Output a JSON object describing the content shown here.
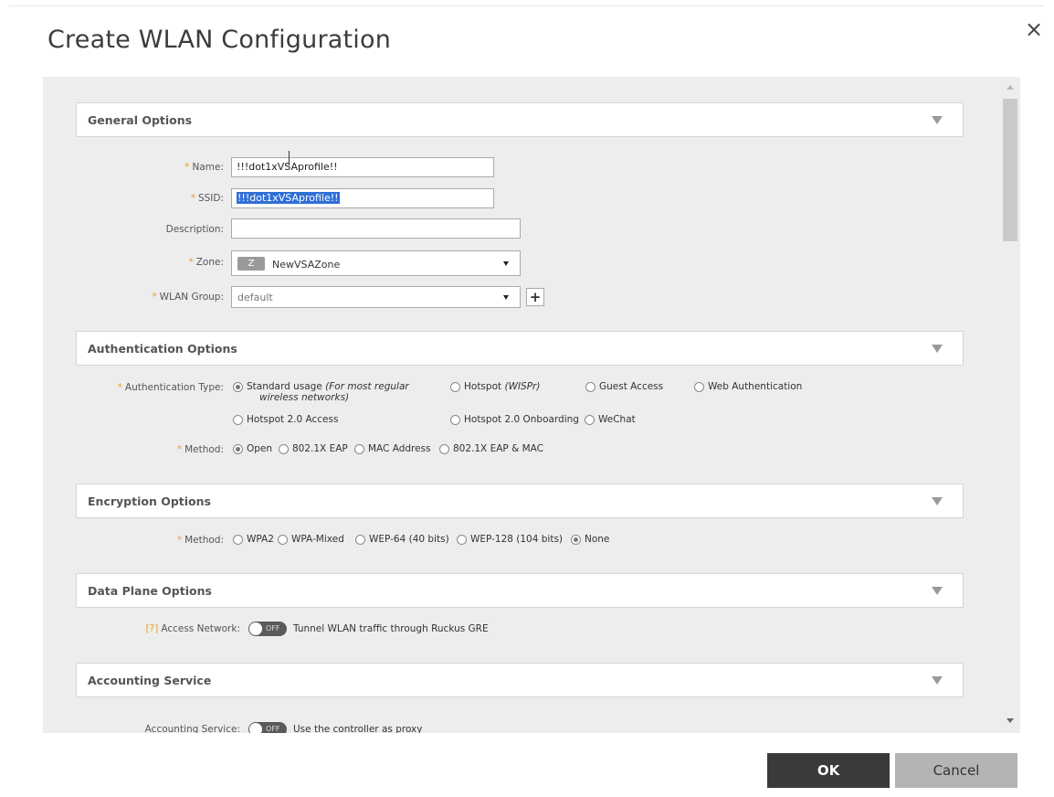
{
  "dialog": {
    "title": "Create WLAN Configuration",
    "close_symbol": "×"
  },
  "general": {
    "title": "General Options",
    "name_label": "Name:",
    "name_value": "!!!dot1xVSAprofile!!",
    "ssid_label": "SSID:",
    "ssid_value": "!!!dot1xVSAprofile!!",
    "description_label": "Description:",
    "description_value": "",
    "zone_label": "Zone:",
    "zone_chip": "Z",
    "zone_value": "NewVSAZone",
    "wlan_group_label": "WLAN Group:",
    "wlan_group_value": "default",
    "add_symbol": "+"
  },
  "authentication": {
    "title": "Authentication Options",
    "type_label": "Authentication Type:",
    "types": {
      "standard": "Standard usage",
      "standard_note": "(For most regular",
      "standard_note2": "wireless networks)",
      "hotspot": "Hotspot",
      "hotspot_note": "(WISPr)",
      "guest": "Guest Access",
      "web": "Web Authentication",
      "hotspot20": "Hotspot 2.0 Access",
      "hotspot20_onboarding": "Hotspot 2.0 Onboarding",
      "wechat": "WeChat"
    },
    "selected_type": "standard",
    "method_label": "Method:",
    "methods": [
      "Open",
      "802.1X EAP",
      "MAC Address",
      "802.1X EAP & MAC"
    ],
    "selected_method": "Open"
  },
  "encryption": {
    "title": "Encryption Options",
    "method_label": "Method:",
    "methods": [
      "WPA2",
      "WPA-Mixed",
      "WEP-64 (40 bits)",
      "WEP-128 (104 bits)",
      "None"
    ],
    "selected_method": "None"
  },
  "data_plane": {
    "title": "Data Plane Options",
    "help_marker": "[?]",
    "access_network_label": "Access Network:",
    "toggle_state": "OFF",
    "toggle_text": "Tunnel WLAN traffic through Ruckus GRE"
  },
  "accounting": {
    "title": "Accounting Service",
    "service_label": "Accounting Service:",
    "toggle_state": "OFF",
    "toggle_text": "Use the controller as proxy"
  },
  "footer": {
    "ok_label": "OK",
    "cancel_label": "Cancel"
  },
  "colors": {
    "ok_bg": "#3a3a3a",
    "cancel_bg": "#b4b4b4",
    "required": "#e8a030",
    "selection": "#2f6fd6"
  }
}
